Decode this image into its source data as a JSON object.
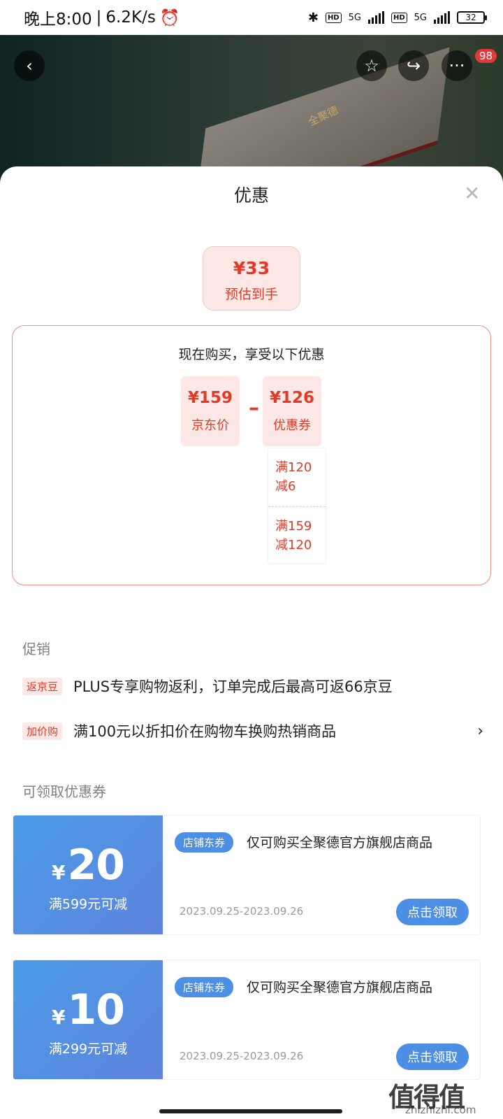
{
  "status_bar": {
    "time": "晚上8:00",
    "speed": "6.2K/s",
    "network_label": "5G",
    "battery": "32"
  },
  "header": {
    "notification_count": "98",
    "product_box_text": "全聚德"
  },
  "sheet": {
    "title": "优惠",
    "estimate": {
      "value": "¥33",
      "label": "预估到手"
    },
    "panel": {
      "title": "现在购买，享受以下优惠",
      "jd_price": {
        "value": "¥159",
        "label": "京东价"
      },
      "coupon": {
        "value": "¥126",
        "label": "优惠券"
      },
      "details": [
        "满120",
        "减6",
        "满159",
        "减120"
      ]
    },
    "promo_section": {
      "title": "促销",
      "items": [
        {
          "tag": "返京豆",
          "text": "PLUS专享购物返利，订单完成后最高可返66京豆"
        },
        {
          "tag": "加价购",
          "text": "满100元以折扣价在购物车换购热销商品"
        }
      ]
    },
    "coupon_section": {
      "title": "可领取优惠券",
      "coupons": [
        {
          "currency": "¥",
          "amount": "20",
          "condition": "满599元可减",
          "tag": "店铺东券",
          "desc": "仅可购买全聚德官方旗舰店商品",
          "date": "2023.09.25-2023.09.26",
          "button": "点击领取"
        },
        {
          "currency": "¥",
          "amount": "10",
          "condition": "满299元可减",
          "tag": "店铺东券",
          "desc": "仅可购买全聚德官方旗舰店商品",
          "date": "2023.09.25-2023.09.26",
          "button": "点击领取"
        }
      ]
    }
  },
  "watermark": {
    "text": "值得值",
    "url": "zhizhizhi.com"
  }
}
